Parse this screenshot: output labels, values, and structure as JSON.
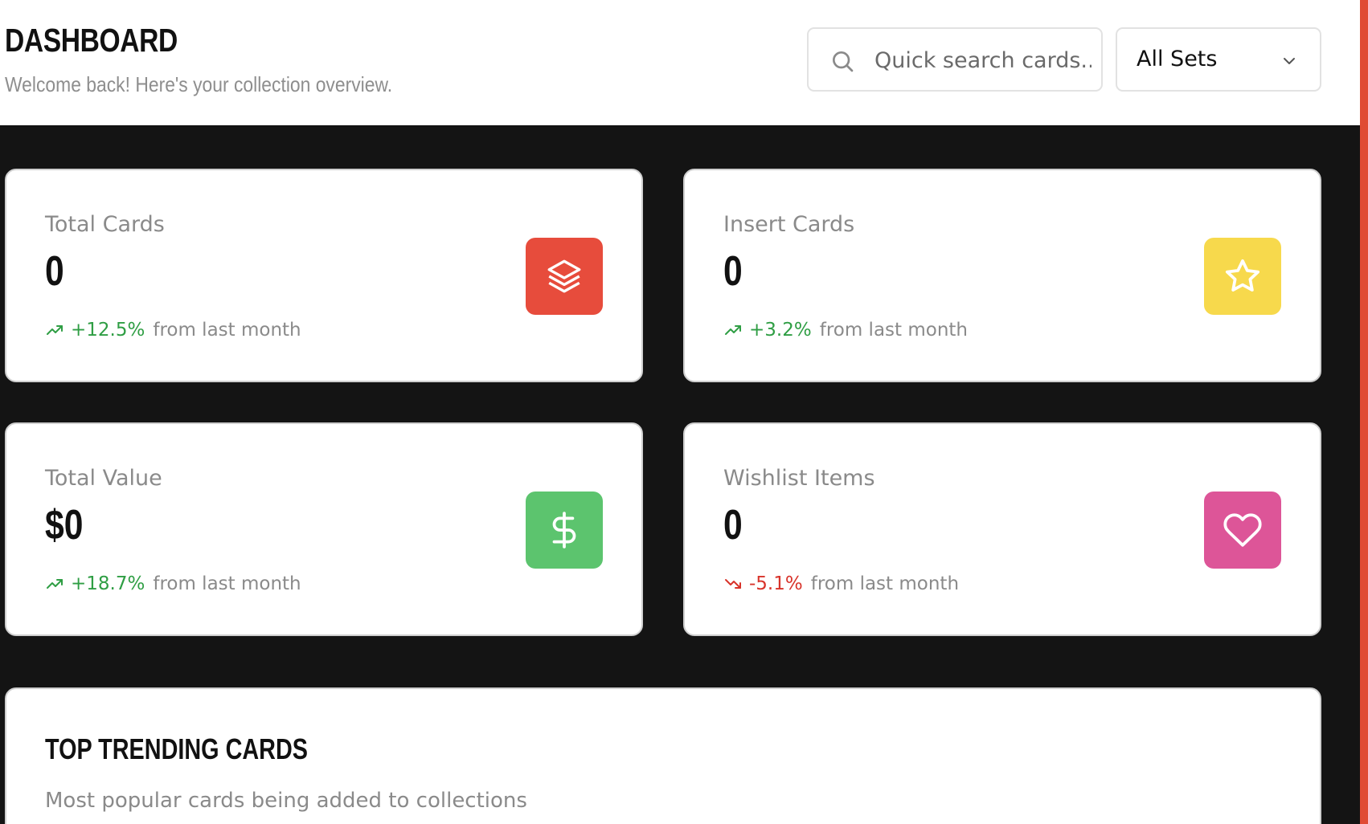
{
  "header": {
    "title": "DASHBOARD",
    "subtitle": "Welcome back! Here's your collection overview."
  },
  "search": {
    "placeholder": "Quick search cards...",
    "icon": "search-icon"
  },
  "set_filter": {
    "selected": "All Sets",
    "icon": "chevron-down-icon"
  },
  "colors": {
    "accent": "#e04b34",
    "total_cards_tile": "#e74c3c",
    "insert_cards_tile": "#f7d94c",
    "total_value_tile": "#5cc46e",
    "wishlist_tile": "#dd5598",
    "trend_up": "#2f9e44",
    "trend_down": "#d8332a"
  },
  "stats": [
    {
      "label": "Total Cards",
      "value": "0",
      "change": "+12.5%",
      "direction": "up",
      "suffix": "from last month",
      "icon": "layers-icon"
    },
    {
      "label": "Insert Cards",
      "value": "0",
      "change": "+3.2%",
      "direction": "up",
      "suffix": "from last month",
      "icon": "star-icon"
    },
    {
      "label": "Total Value",
      "value": "$0",
      "change": "+18.7%",
      "direction": "up",
      "suffix": "from last month",
      "icon": "dollar-icon"
    },
    {
      "label": "Wishlist Items",
      "value": "0",
      "change": "-5.1%",
      "direction": "down",
      "suffix": "from last month",
      "icon": "heart-icon"
    }
  ],
  "trending": {
    "title": "TOP TRENDING CARDS",
    "subtitle": "Most popular cards being added to collections"
  }
}
